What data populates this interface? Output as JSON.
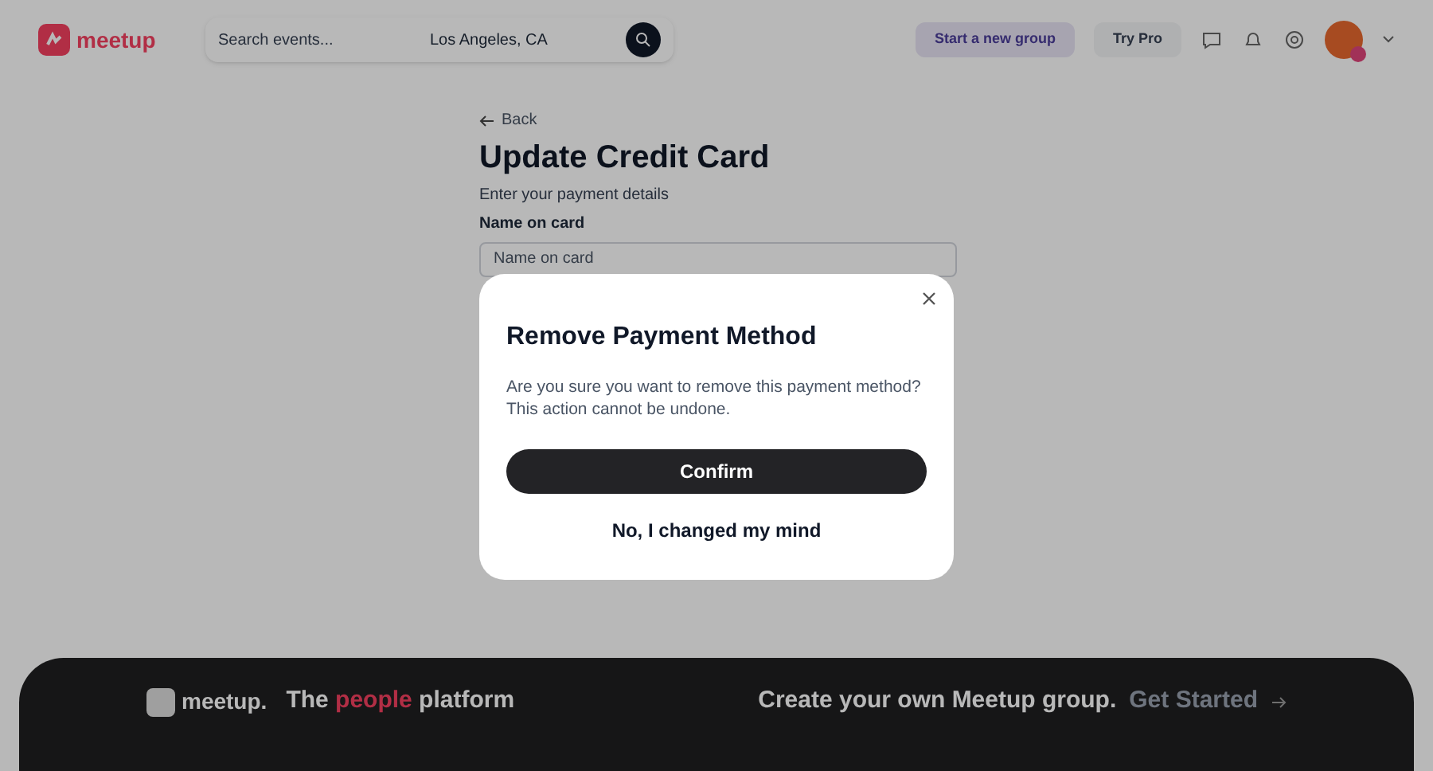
{
  "header": {
    "logo": "meetup",
    "search": {
      "placeholder": "Search events...",
      "location": "Los Angeles, CA"
    },
    "buttons": [
      {
        "label": "Start a new group",
        "kind": "primary"
      },
      {
        "label": "Try Pro",
        "kind": "secondary"
      }
    ]
  },
  "page": {
    "back": "Back",
    "title": "Update Credit Card",
    "subtitle": "Enter your payment details",
    "field_label": "Name on card",
    "field": {
      "placeholder": "Name on card"
    }
  },
  "footer": {
    "logo": "meetup.",
    "tagline": [
      {
        "text": "The ",
        "highlight": false
      },
      {
        "text": "people",
        "highlight": true
      },
      {
        "text": " platform",
        "highlight": false
      }
    ],
    "cta": "Create your own Meetup group.",
    "link": "Get Started"
  },
  "dialog": {
    "title": "Remove Payment Method",
    "message": "Are you sure you want to remove this payment method? This action cannot be undone.",
    "confirm": "Confirm",
    "cancel": "No, I changed my mind"
  }
}
